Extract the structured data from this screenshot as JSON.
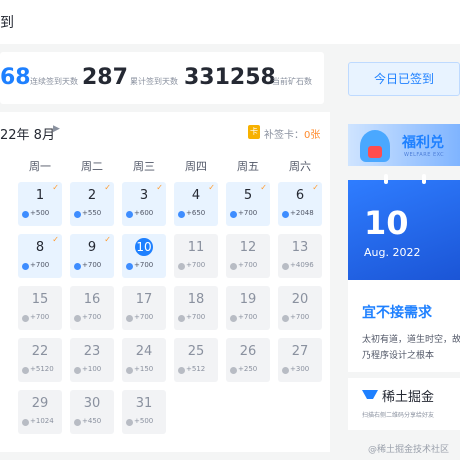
{
  "header": {
    "title": "到"
  },
  "stats": {
    "current_partial": "68",
    "continuous_label": "连续签到天数",
    "continuous_value": "287",
    "total_label": "累计签到天数",
    "total_value": "331258",
    "ore_label": "当前矿石数"
  },
  "calendar": {
    "month_label": "22年 8月",
    "supplement_card_label": "补签卡：",
    "supplement_card_count": "0张",
    "weekdays": [
      "周一",
      "周二",
      "周三",
      "周四",
      "周五",
      "周六"
    ],
    "rows": [
      [
        {
          "day": "1",
          "reward": "+500",
          "signed": true,
          "checked": true
        },
        {
          "day": "2",
          "reward": "+550",
          "signed": true,
          "checked": true
        },
        {
          "day": "3",
          "reward": "+600",
          "signed": true,
          "checked": true
        },
        {
          "day": "4",
          "reward": "+650",
          "signed": true,
          "checked": true
        },
        {
          "day": "5",
          "reward": "+700",
          "signed": true,
          "checked": true
        },
        {
          "day": "6",
          "reward": "+2048",
          "signed": true,
          "checked": true
        }
      ],
      [
        {
          "day": "8",
          "reward": "+700",
          "signed": true,
          "checked": true
        },
        {
          "day": "9",
          "reward": "+700",
          "signed": true,
          "checked": true
        },
        {
          "day": "10",
          "reward": "+700",
          "signed": true,
          "checked": false,
          "today": true
        },
        {
          "day": "11",
          "reward": "+700",
          "signed": false
        },
        {
          "day": "12",
          "reward": "+700",
          "signed": false
        },
        {
          "day": "13",
          "reward": "+4096",
          "signed": false
        }
      ],
      [
        {
          "day": "15",
          "reward": "+700",
          "signed": false
        },
        {
          "day": "16",
          "reward": "+700",
          "signed": false
        },
        {
          "day": "17",
          "reward": "+700",
          "signed": false
        },
        {
          "day": "18",
          "reward": "+700",
          "signed": false
        },
        {
          "day": "19",
          "reward": "+700",
          "signed": false
        },
        {
          "day": "20",
          "reward": "+700",
          "signed": false
        }
      ],
      [
        {
          "day": "22",
          "reward": "+5120",
          "signed": false
        },
        {
          "day": "23",
          "reward": "+100",
          "signed": false
        },
        {
          "day": "24",
          "reward": "+150",
          "signed": false
        },
        {
          "day": "25",
          "reward": "+512",
          "signed": false
        },
        {
          "day": "26",
          "reward": "+250",
          "signed": false
        },
        {
          "day": "27",
          "reward": "+300",
          "signed": false
        }
      ],
      [
        {
          "day": "29",
          "reward": "+1024",
          "signed": false
        },
        {
          "day": "30",
          "reward": "+450",
          "signed": false
        },
        {
          "day": "31",
          "reward": "+500",
          "signed": false
        }
      ]
    ]
  },
  "sidebar": {
    "signed_button": "今日已签到",
    "welfare_title": "福利兑",
    "welfare_sub": "WELFARE EXC",
    "calendar_day": "10",
    "calendar_month": "Aug. 2022",
    "quote_title": "宜不接需求",
    "quote_line_1": "太初有道，道生时空，故",
    "quote_line_2": "乃程序设计之根本",
    "brand_name": "稀土掘金",
    "brand_sub": "扫描右侧二维码分享给好友"
  },
  "watermark": "@稀土掘金技术社区",
  "colors": {
    "accent": "#1e80ff",
    "check": "#ff9a2e",
    "signed_bg": "#e8f3ff",
    "unsigned_bg": "#f2f3f5"
  }
}
